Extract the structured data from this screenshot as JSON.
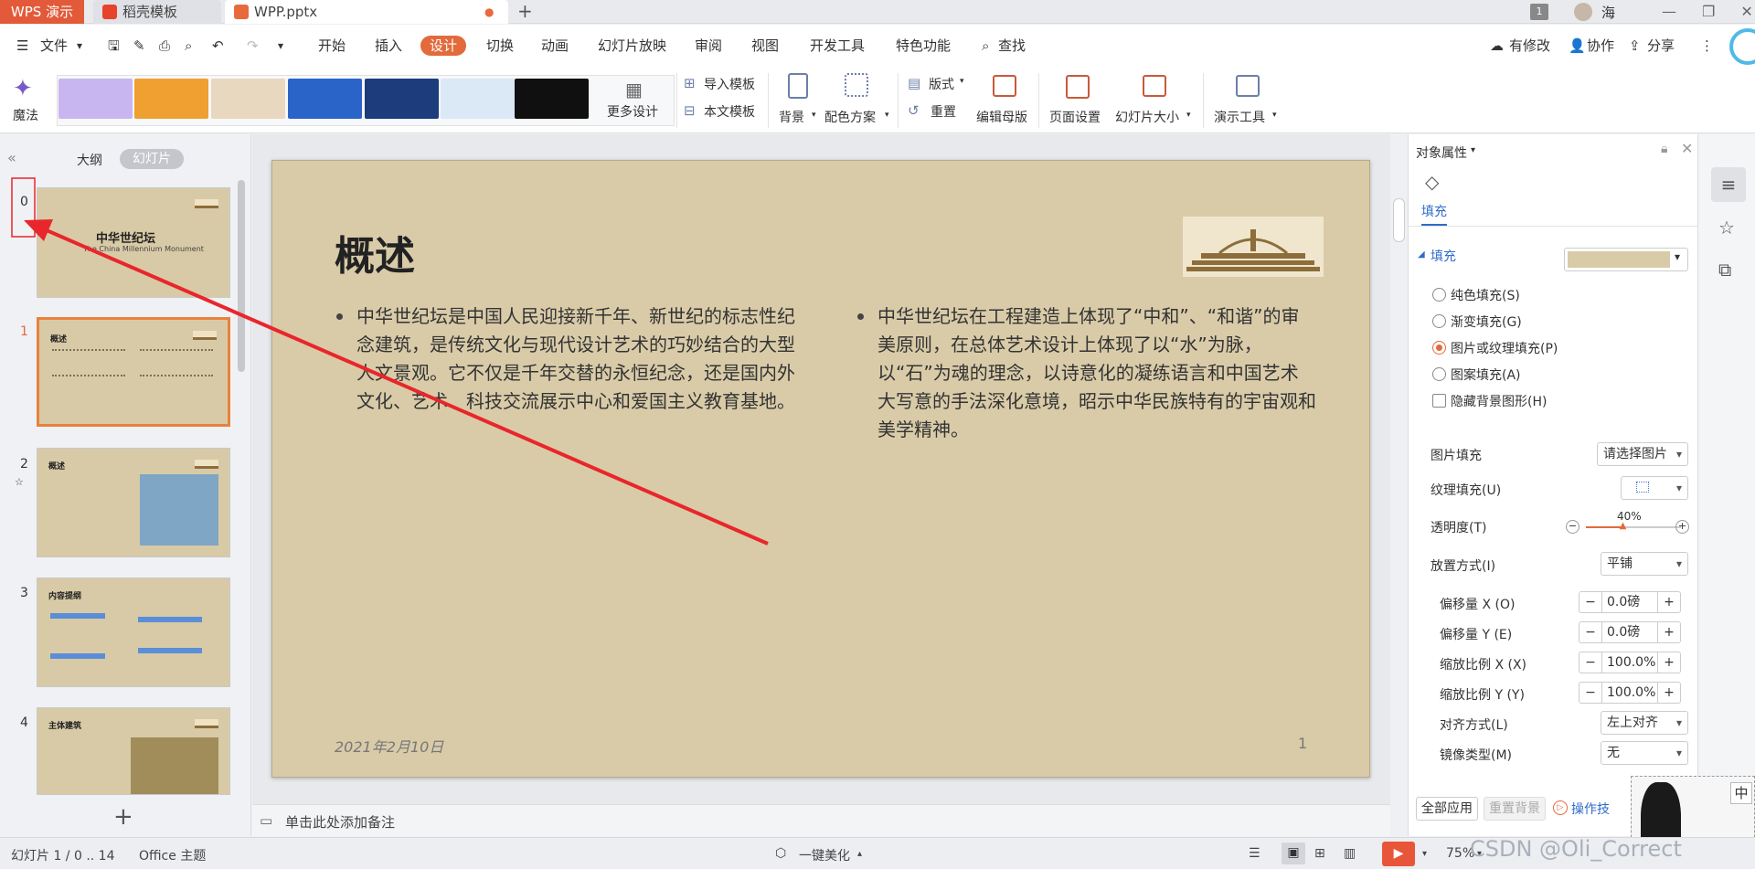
{
  "titlebar": {
    "app_button": "WPS 演示",
    "tabs": [
      {
        "label": "稻壳模板"
      },
      {
        "label": "WPP.pptx"
      }
    ],
    "new_tab": "+",
    "page_badge": "1",
    "user": "海"
  },
  "menu": {
    "file": "文件",
    "items": [
      "开始",
      "插入",
      "设计",
      "切换",
      "动画",
      "幻灯片放映",
      "审阅",
      "视图",
      "开发工具",
      "特色功能"
    ],
    "search": "查找",
    "right": [
      "有修改",
      "协作",
      "分享"
    ]
  },
  "ribbon": {
    "magic": "魔法",
    "more_design": "更多设计",
    "import_template": "导入模板",
    "text_template": "本文模板",
    "background": "背景",
    "color_scheme": "配色方案",
    "layout": "版式",
    "reset": "重置",
    "edit_master": "编辑母版",
    "page_setup": "页面设置",
    "slide_size": "幻灯片大小",
    "presentation_tools": "演示工具",
    "theme_thumb_colors": [
      "#c8b6f0",
      "#f0a030",
      "#e8d8c0",
      "#2b64c8",
      "#1c3c7c",
      "#dbe8f6",
      "#101010"
    ]
  },
  "leftpanel": {
    "tab_outline": "大纲",
    "tab_slides": "幻灯片",
    "slides": [
      {
        "num": "0",
        "title": "中华世纪坛",
        "subtitle": "The China Millennium Monument"
      },
      {
        "num": "1",
        "title": "概述"
      },
      {
        "num": "2",
        "title": "概述"
      },
      {
        "num": "3",
        "title": "内容提纲"
      },
      {
        "num": "4",
        "title": "主体建筑"
      }
    ],
    "add": "+"
  },
  "slide": {
    "title": "概述",
    "col1": "中华世纪坛是中国人民迎接新千年、新世纪的标志性纪念建筑，是传统文化与现代设计艺术的巧妙结合的大型人文景观。它不仅是千年交替的永恒纪念，还是国内外文化、艺术、科技交流展示中心和爱国主义教育基地。",
    "col2": "中华世纪坛在工程建造上体现了“中和”、“和谐”的审美原则，在总体艺术设计上体现了以“水”为脉，以“石”为魂的理念，以诗意化的凝练语言和中国艺术大写意的手法深化意境，昭示中华民族特有的宇宙观和美学精神。",
    "date": "2021年2月10日",
    "page": "1"
  },
  "notes": {
    "placeholder": "单击此处添加备注"
  },
  "props": {
    "header": "对象属性",
    "tab": "填充",
    "section": "填充",
    "radios": [
      {
        "label": "纯色填充(S)",
        "checked": false
      },
      {
        "label": "渐变填充(G)",
        "checked": false
      },
      {
        "label": "图片或纹理填充(P)",
        "checked": true
      },
      {
        "label": "图案填充(A)",
        "checked": false
      }
    ],
    "hide_bg": "隐藏背景图形(H)",
    "picture_fill_label": "图片填充",
    "picture_fill_value": "请选择图片",
    "texture_fill_label": "纹理填充(U)",
    "transparency_label": "透明度(T)",
    "transparency_value": "40%",
    "transparency_fraction": 0.4,
    "placement_label": "放置方式(I)",
    "placement_value": "平铺",
    "offset_x_label": "偏移量 X (O)",
    "offset_x_value": "0.0磅",
    "offset_y_label": "偏移量 Y (E)",
    "offset_y_value": "0.0磅",
    "scale_x_label": "缩放比例 X (X)",
    "scale_x_value": "100.0%",
    "scale_y_label": "缩放比例 Y (Y)",
    "scale_y_value": "100.0%",
    "align_label": "对齐方式(L)",
    "align_value": "左上对齐",
    "mirror_label": "镜像类型(M)",
    "mirror_value": "无",
    "apply_all": "全部应用",
    "reset_bg": "重置背景",
    "tips": "操作技"
  },
  "status": {
    "slide_info": "幻灯片 1 / 0 .. 14",
    "theme": "Office 主题",
    "beautify": "一键美化",
    "zoom": "75%",
    "watermark": "CSDN @Oli_Correct"
  },
  "ime": {
    "label": "中"
  },
  "colors": {
    "accent": "#e36a3b",
    "wps_red": "#e25a39",
    "arrow": "#e8262b"
  }
}
